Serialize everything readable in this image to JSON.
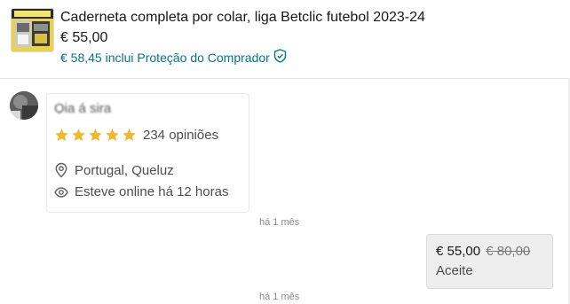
{
  "item": {
    "title": "Caderneta completa por colar, liga Betclic futebol 2023-24",
    "price": "€ 55,00",
    "protection_text": "€ 58,45 inclui Proteção do Comprador",
    "thumbnail_icon": "sticker-album-thumbnail"
  },
  "profile": {
    "name": "Qia          á      sira",
    "stars": 5,
    "reviews": "234 opiniões",
    "location": "Portugal, Queluz",
    "online": "Esteve online há 12 horas"
  },
  "timestamps": {
    "first": "há 1 mês",
    "second": "há 1 mês"
  },
  "offer": {
    "price": "€ 55,00",
    "old_price": "€ 80,00",
    "status": "Aceite"
  },
  "colors": {
    "accent": "#007782",
    "star": "#f0b92c"
  }
}
